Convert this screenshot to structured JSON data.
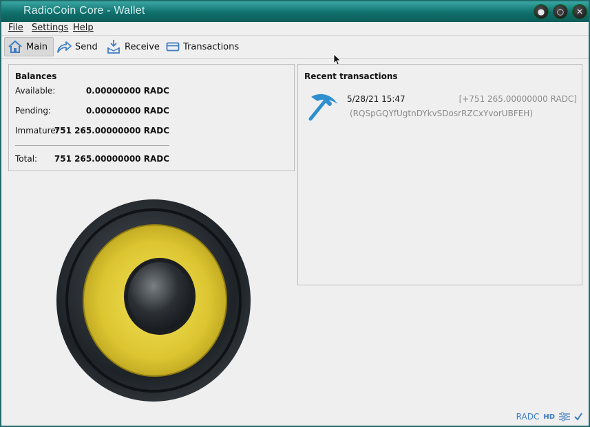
{
  "window": {
    "title": "RadioCoin Core - Wallet"
  },
  "menu": [
    "File",
    "Settings",
    "Help"
  ],
  "toolbar": {
    "main": "Main",
    "send": "Send",
    "receive": "Receive",
    "transactions": "Transactions"
  },
  "balances": {
    "title": "Balances",
    "available_label": "Available:",
    "available_value": "0.00000000 RADC",
    "pending_label": "Pending:",
    "pending_value": "0.00000000 RADC",
    "immature_label": "Immature:",
    "immature_value": "751 265.00000000 RADC",
    "total_label": "Total:",
    "total_value": "751 265.00000000 RADC"
  },
  "recent": {
    "title": "Recent transactions",
    "items": [
      {
        "date": "5/28/21 15:47",
        "amount": "[+751 265.00000000 RADC]",
        "address": "(RQSpGQYfUgtnDYkvSDosrRZCxYvorUBFEH)",
        "icon": "pickaxe-icon"
      }
    ]
  },
  "status": {
    "unit": "RADC",
    "hd": "HD"
  },
  "colors": {
    "titlebar": "#0f6f6c",
    "accent": "#3d7cc4",
    "speaker_cone": "#e6cf3a"
  }
}
